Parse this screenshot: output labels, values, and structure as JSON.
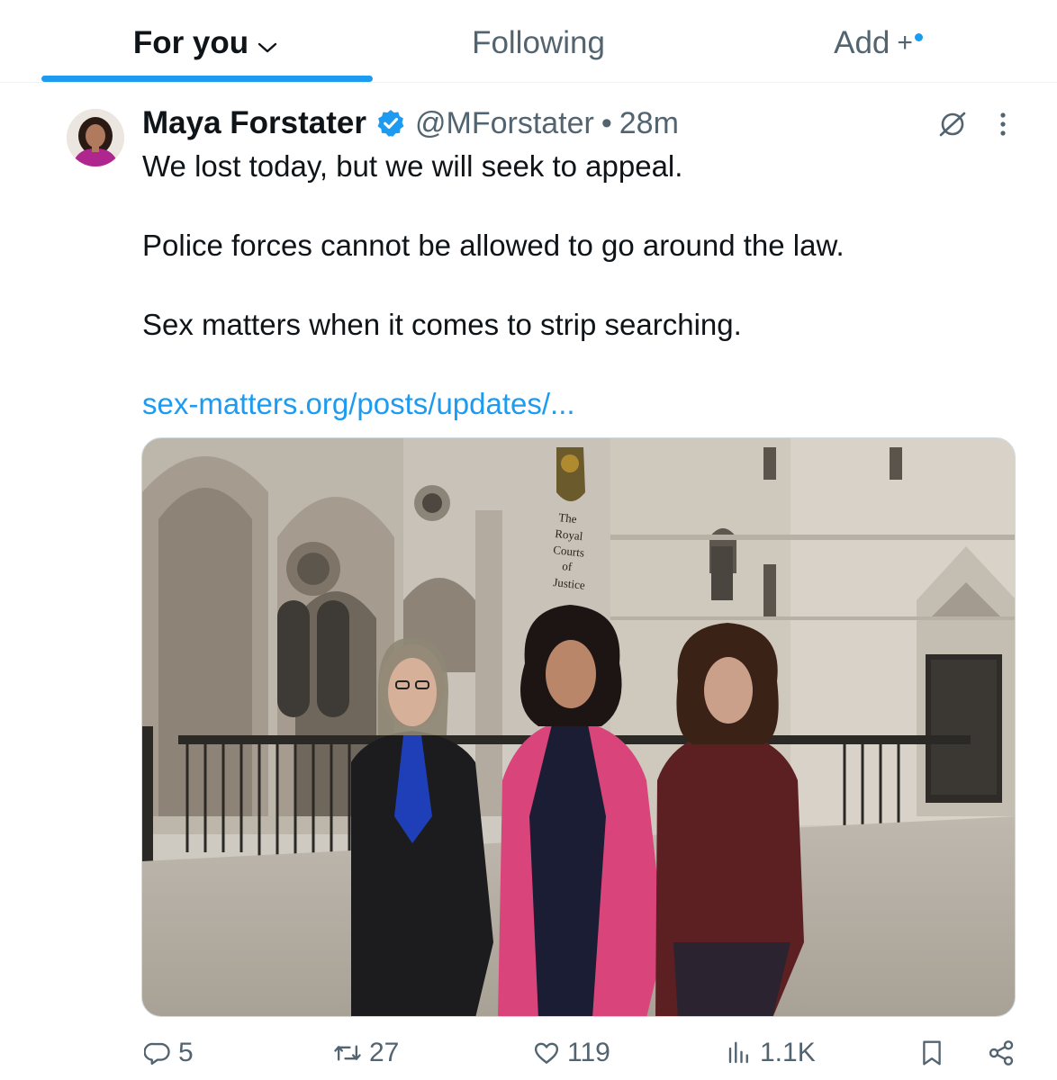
{
  "tabs": {
    "for_you": "For you",
    "following": "Following",
    "add": "Add",
    "add_symbol": "+"
  },
  "tweet": {
    "author_name": "Maya Forstater",
    "handle": "@MForstater",
    "separator": "•",
    "time": "28m",
    "verified": true,
    "lines": [
      "We lost today, but we will seek to appeal.",
      "Police forces cannot be allowed to go around the law.",
      "Sex matters when it comes to strip searching."
    ],
    "link_text": "sex-matters.org/posts/updates/...",
    "photo_sign_text": [
      "The",
      "Royal",
      "Courts",
      "of",
      "Justice"
    ]
  },
  "actions": {
    "replies": "5",
    "reposts": "27",
    "likes": "119",
    "views": "1.1K"
  },
  "colors": {
    "accent": "#1d9bf0",
    "text_primary": "#0f1419",
    "text_secondary": "#536471",
    "divider": "#eff3f4"
  },
  "icons": [
    "chevron-down-icon",
    "verified-badge-icon",
    "grok-icon",
    "more-icon",
    "reply-icon",
    "repost-icon",
    "like-icon",
    "views-icon",
    "bookmark-icon",
    "share-icon"
  ]
}
